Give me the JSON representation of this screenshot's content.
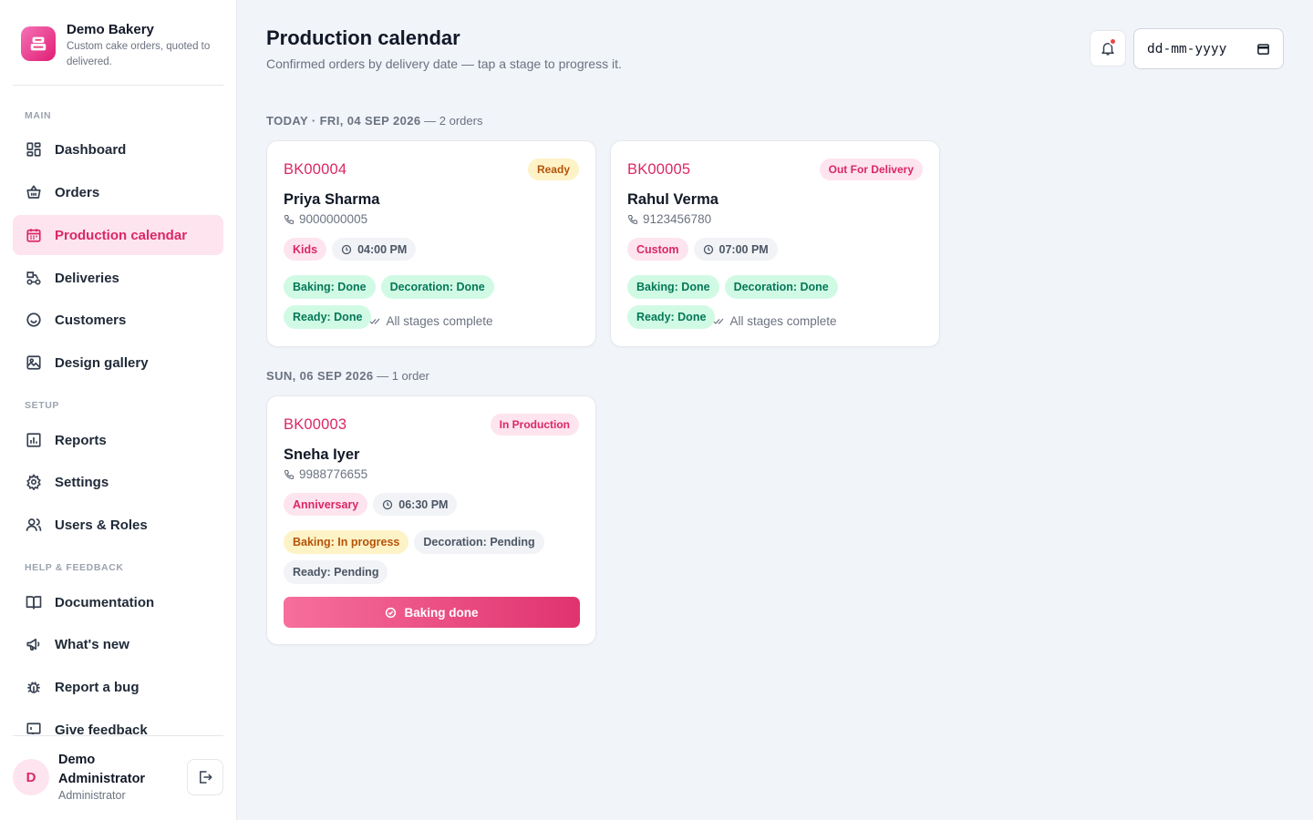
{
  "brand": {
    "name": "Demo Bakery",
    "tagline": "Custom cake orders, quoted to delivered."
  },
  "sidebar": {
    "sections": {
      "main": "MAIN",
      "setup": "SETUP",
      "help": "HELP & FEEDBACK"
    },
    "items": [
      {
        "label": "Dashboard",
        "icon": "dashboard-icon"
      },
      {
        "label": "Orders",
        "icon": "basket-icon"
      },
      {
        "label": "Production calendar",
        "icon": "calendar-icon",
        "active": true
      },
      {
        "label": "Deliveries",
        "icon": "delivery-bike-icon"
      },
      {
        "label": "Customers",
        "icon": "customers-smile-icon"
      },
      {
        "label": "Design gallery",
        "icon": "gallery-image-icon"
      },
      {
        "label": "Reports",
        "icon": "bar-chart-icon"
      },
      {
        "label": "Settings",
        "icon": "gear-icon"
      },
      {
        "label": "Users & Roles",
        "icon": "users-icon"
      },
      {
        "label": "Documentation",
        "icon": "book-icon"
      },
      {
        "label": "What's new",
        "icon": "megaphone-icon"
      },
      {
        "label": "Report a bug",
        "icon": "bug-icon"
      },
      {
        "label": "Give feedback",
        "icon": "feedback-icon"
      }
    ]
  },
  "user": {
    "initial": "D",
    "name": "Demo Administrator",
    "role": "Administrator"
  },
  "header": {
    "title": "Production calendar",
    "subtitle": "Confirmed orders by delivery date — tap a stage to progress it.",
    "date_placeholder": "dd-mm-yyyy"
  },
  "days": [
    {
      "label": "TODAY · FRI, 04 SEP 2026",
      "count": "— 2 orders",
      "orders": [
        {
          "id": "BK00004",
          "status": "Ready",
          "customer": "Priya Sharma",
          "phone": "9000000005",
          "category": "Kids",
          "time": "04:00 PM",
          "stages": [
            "Baking: Done",
            "Decoration: Done",
            "Ready: Done"
          ],
          "note": "All stages complete"
        },
        {
          "id": "BK00005",
          "status": "Out For Delivery",
          "customer": "Rahul Verma",
          "phone": "9123456780",
          "category": "Custom",
          "time": "07:00 PM",
          "stages": [
            "Baking: Done",
            "Decoration: Done",
            "Ready: Done"
          ],
          "note": "All stages complete"
        }
      ]
    },
    {
      "label": "SUN, 06 SEP 2026",
      "count": "— 1 order",
      "orders": [
        {
          "id": "BK00003",
          "status": "In Production",
          "customer": "Sneha Iyer",
          "phone": "9988776655",
          "category": "Anniversary",
          "time": "06:30 PM",
          "stages": [
            "Baking: In progress",
            "Decoration: Pending",
            "Ready: Pending"
          ],
          "action": "Baking done"
        }
      ]
    }
  ],
  "colors": {
    "accent": "#db2766",
    "accent_soft": "#fde4ee",
    "done_bg": "#d1fae5",
    "done_text": "#047857",
    "progress_bg": "#fef3c7",
    "progress_text": "#b45309"
  }
}
